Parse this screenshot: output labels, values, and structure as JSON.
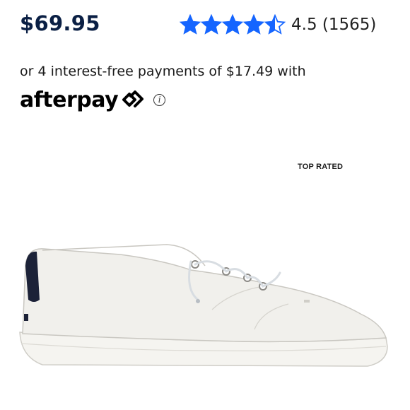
{
  "product": {
    "price": "$69.95",
    "rating_value": 4.5,
    "rating_text": "4.5 (1565)",
    "star_color": "#1565ff",
    "badge": "TOP RATED",
    "image_icon": "sneaker-image"
  },
  "afterpay": {
    "message": "or 4 interest-free payments of $17.49 with",
    "logo_text": "afterpay",
    "info_icon": "info-icon"
  }
}
